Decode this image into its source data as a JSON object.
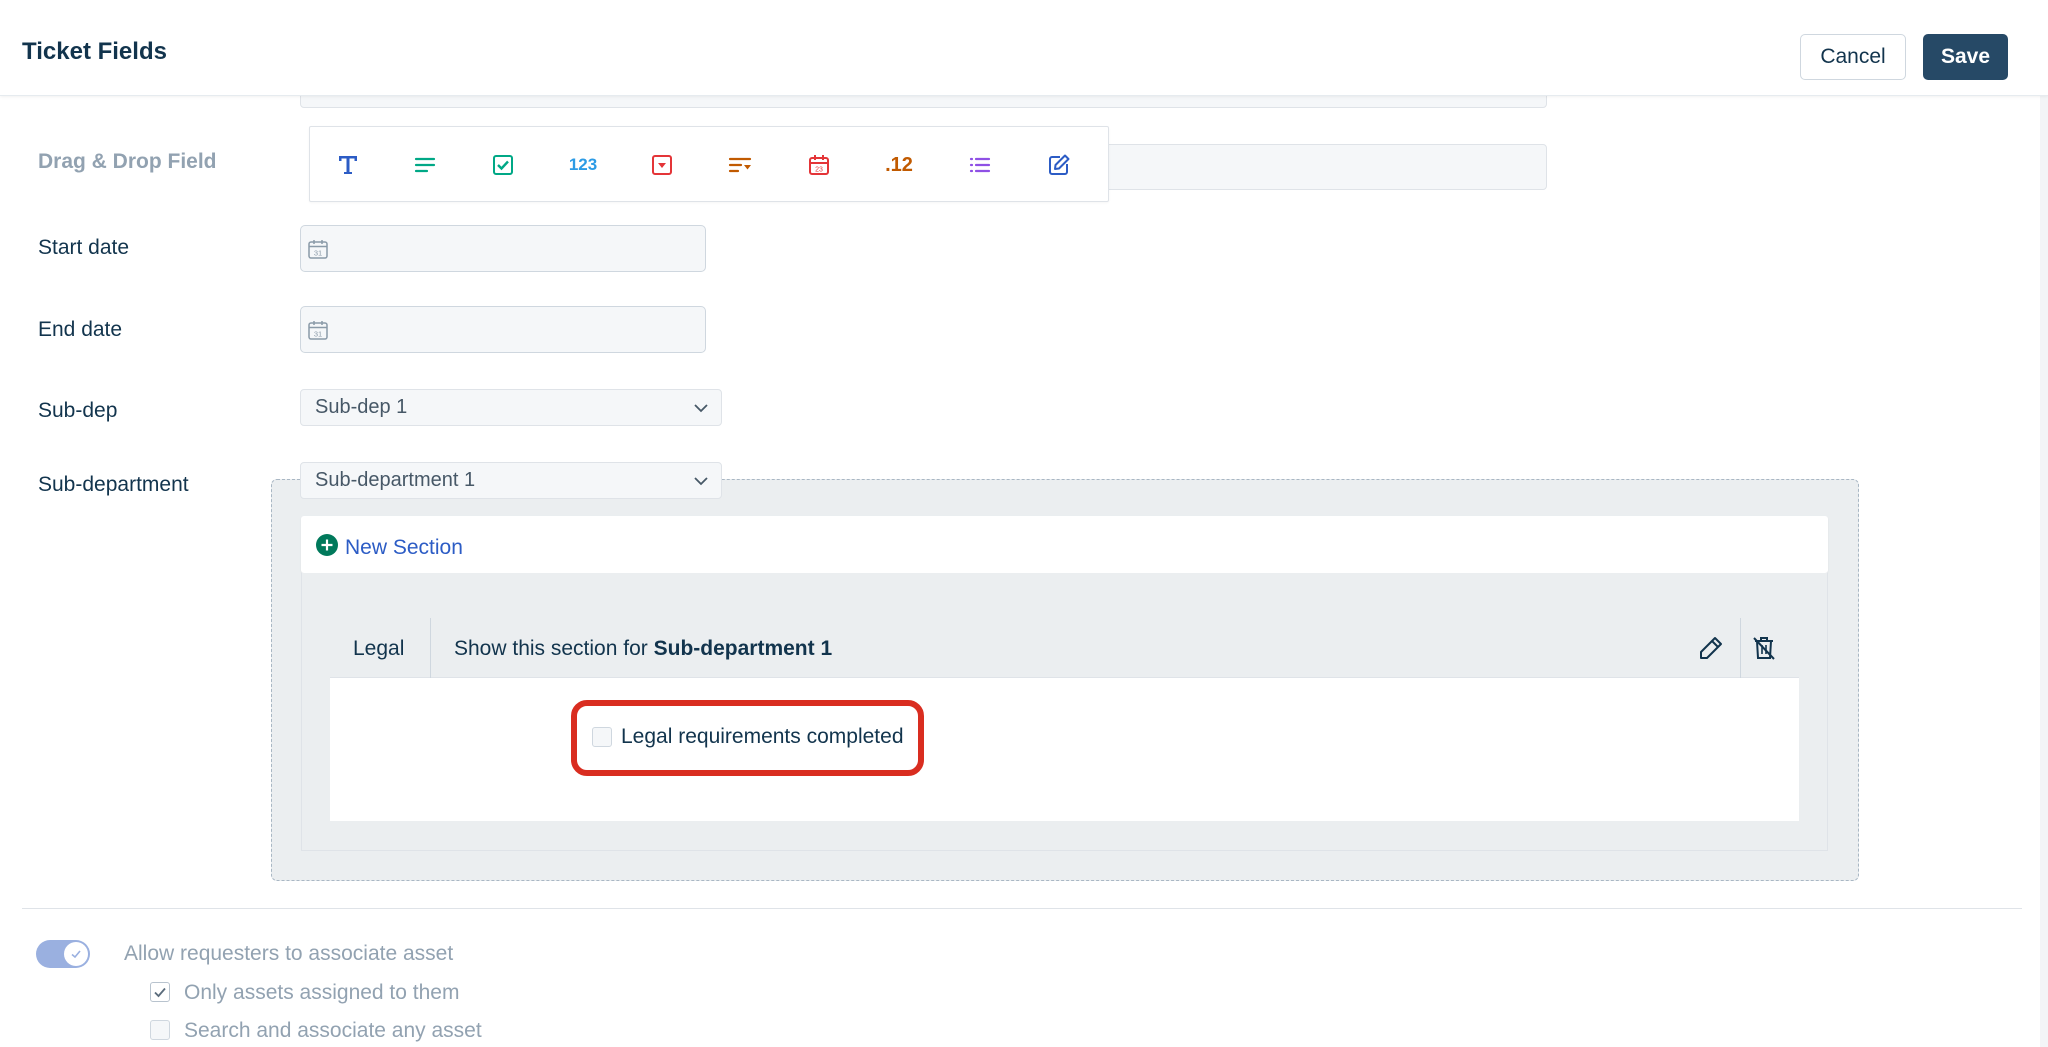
{
  "header": {
    "title": "Ticket Fields",
    "cancel_label": "Cancel",
    "save_label": "Save"
  },
  "fields": {
    "drag_drop_label": "Drag & Drop Field",
    "start_date_label": "Start date",
    "end_date_label": "End date",
    "sub_dep_label": "Sub-dep",
    "sub_dep_value": "Sub-dep 1",
    "sub_department_label": "Sub-department",
    "sub_department_value": "Sub-department 1"
  },
  "toolbar": {
    "items": [
      {
        "name": "single-line-text",
        "glyph": "T",
        "color": "#2c5cc5"
      },
      {
        "name": "paragraph-text",
        "color": "#00a886"
      },
      {
        "name": "checkbox",
        "color": "#00a886"
      },
      {
        "name": "number",
        "glyph": "123",
        "color": "#2c9be5"
      },
      {
        "name": "dropdown",
        "color": "#e43538"
      },
      {
        "name": "dependent-field",
        "color": "#c15a00"
      },
      {
        "name": "date",
        "color": "#e43538"
      },
      {
        "name": "decimal",
        "glyph": ".12",
        "color": "#c15a00"
      },
      {
        "name": "multi-select",
        "color": "#8f50e5"
      },
      {
        "name": "content",
        "color": "#2c5cc5"
      }
    ]
  },
  "sections": {
    "new_section_label": "New Section",
    "section_name": "Legal",
    "condition_prefix": "Show this section for",
    "condition_value": "Sub-department 1",
    "field_label": "Legal requirements completed"
  },
  "assets": {
    "allow_label": "Allow requesters to associate asset",
    "option_assigned": "Only assets assigned to them",
    "option_any": "Search and associate any asset"
  },
  "colors": {
    "primary": "#264966",
    "link": "#2c5cc5",
    "highlight": "#d92d20",
    "add_icon": "#00795b"
  }
}
